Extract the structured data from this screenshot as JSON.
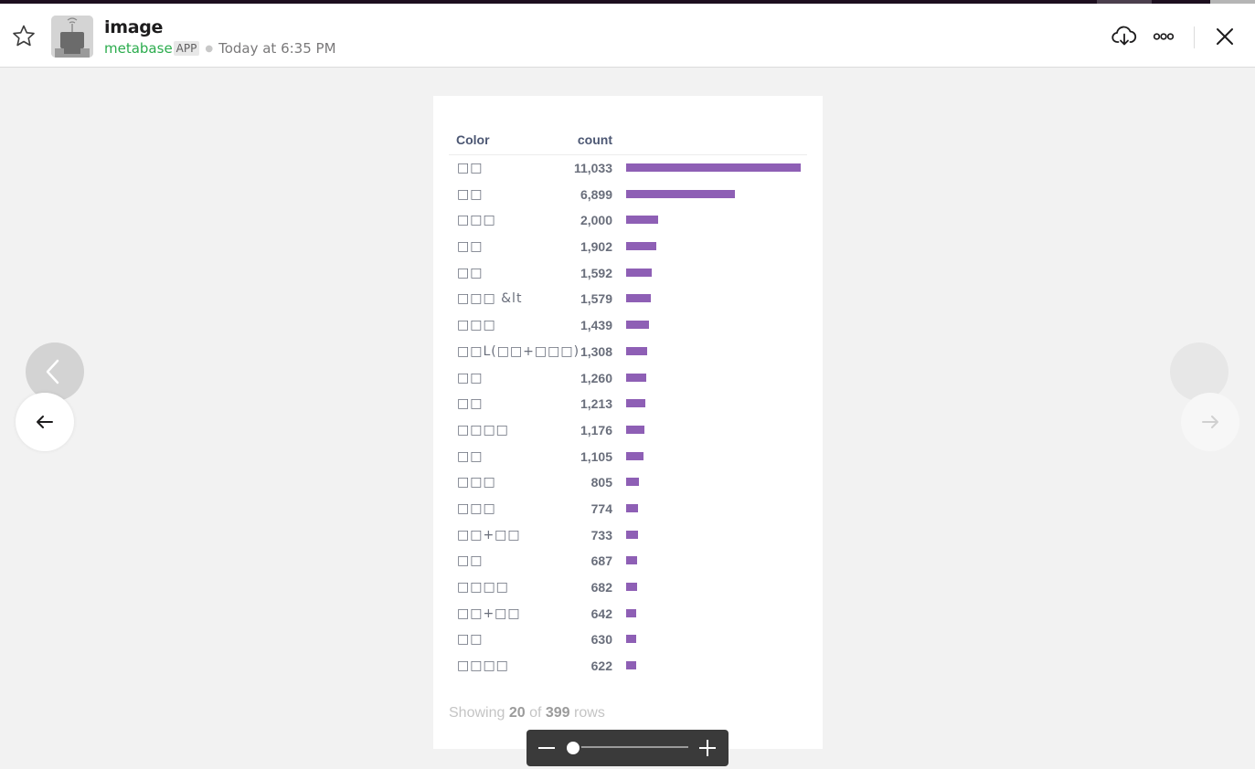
{
  "header": {
    "title": "image",
    "app_name": "metabase",
    "app_badge": "APP",
    "timestamp": "Today at 6:35 PM",
    "star_icon": "star-icon",
    "download_icon": "cloud-download-icon",
    "more_icon": "more-horizontal-icon",
    "close_icon": "close-icon"
  },
  "table": {
    "headers": {
      "color": "Color",
      "count": "count"
    },
    "bar_color": "#8e5fb5",
    "rows": [
      {
        "color": "□□",
        "count": "11,033",
        "value": 11033
      },
      {
        "color": "□□",
        "count": "6,899",
        "value": 6899
      },
      {
        "color": "□□□",
        "count": "2,000",
        "value": 2000
      },
      {
        "color": "□□",
        "count": "1,902",
        "value": 1902
      },
      {
        "color": "□□",
        "count": "1,592",
        "value": 1592
      },
      {
        "color": "□□□ &lt",
        "count": "1,579",
        "value": 1579
      },
      {
        "color": "□□□",
        "count": "1,439",
        "value": 1439
      },
      {
        "color": "□□L(□□+□□□)",
        "count": "1,308",
        "value": 1308
      },
      {
        "color": "□□",
        "count": "1,260",
        "value": 1260
      },
      {
        "color": "□□",
        "count": "1,213",
        "value": 1213
      },
      {
        "color": "□□□□",
        "count": "1,176",
        "value": 1176
      },
      {
        "color": "□□",
        "count": "1,105",
        "value": 1105
      },
      {
        "color": "□□□",
        "count": "805",
        "value": 805
      },
      {
        "color": "□□□",
        "count": "774",
        "value": 774
      },
      {
        "color": "□□+□□",
        "count": "733",
        "value": 733
      },
      {
        "color": "□□",
        "count": "687",
        "value": 687
      },
      {
        "color": "□□□□",
        "count": "682",
        "value": 682
      },
      {
        "color": "□□+□□",
        "count": "642",
        "value": 642
      },
      {
        "color": "□□",
        "count": "630",
        "value": 630
      },
      {
        "color": "□□□□",
        "count": "622",
        "value": 622
      }
    ],
    "footer": {
      "prefix": "Showing",
      "shown": "20",
      "of": "of",
      "total": "399",
      "suffix": "rows"
    }
  },
  "zoom": {
    "minus_icon": "minus-icon",
    "plus_icon": "plus-icon",
    "level": 0
  },
  "nav": {
    "prev_icon": "arrow-left-icon",
    "next_icon": "arrow-right-icon",
    "ghost_prev_icon": "chevron-left-icon"
  }
}
